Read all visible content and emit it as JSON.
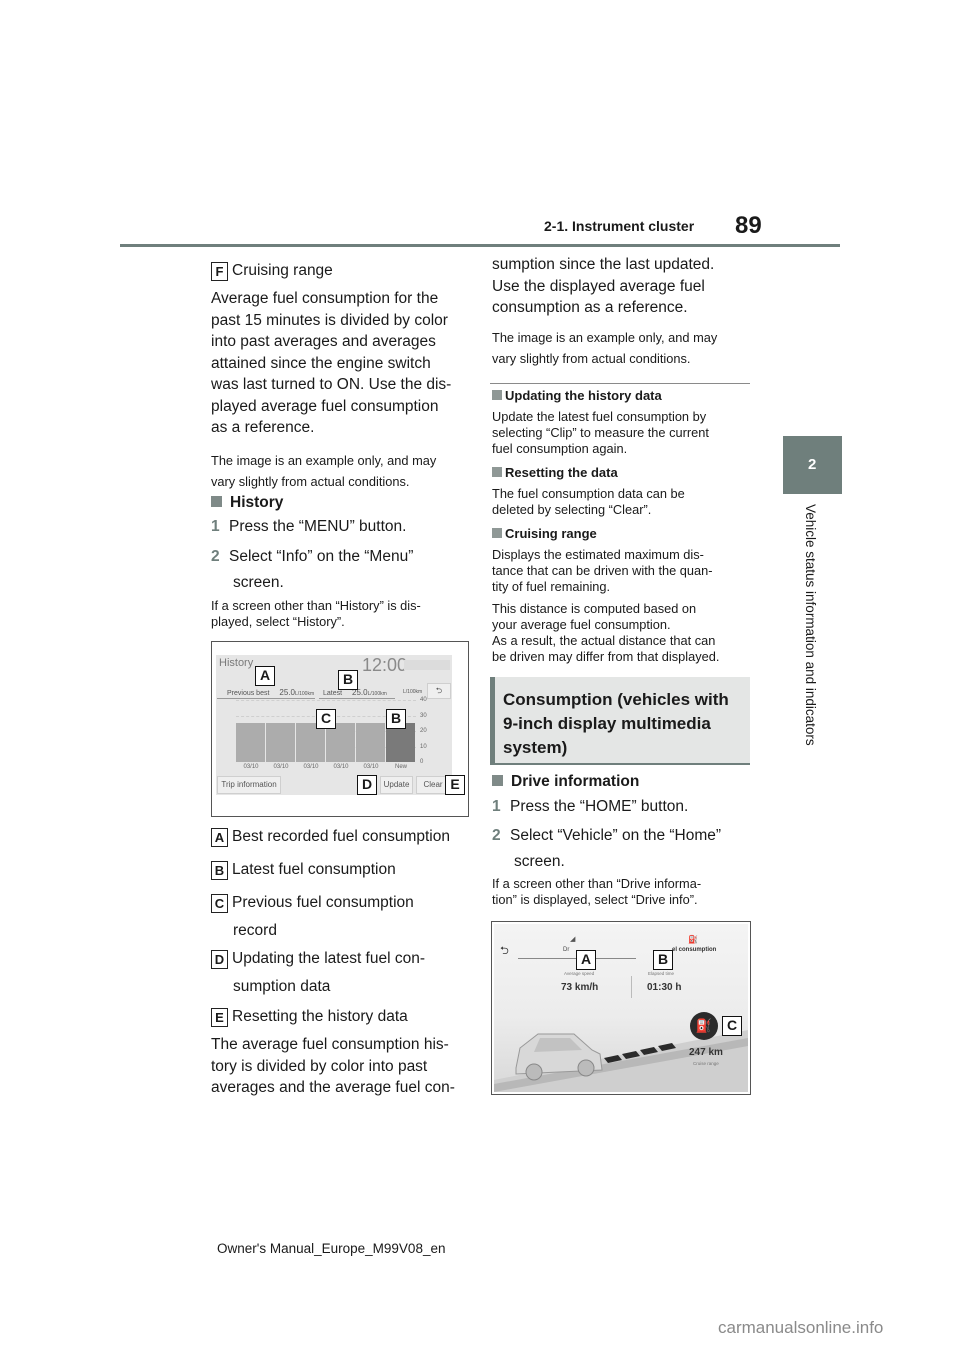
{
  "header": {
    "section": "2-1. Instrument cluster",
    "page_number": "89"
  },
  "side_tab": {
    "chapter_number": "2",
    "chapter_title": "Vehicle status information and indicators"
  },
  "left_column": {
    "item_f": {
      "letter": "F",
      "text": "Cruising range"
    },
    "paragraph1": [
      "Average fuel consumption for the",
      "past 15 minutes is divided by color",
      "into past averages and averages",
      "attained since the engine switch",
      "was last turned to ON. Use the dis-",
      "played average fuel consumption",
      "as a reference."
    ],
    "note1": [
      "The image is an example only, and may",
      "vary slightly from actual conditions."
    ],
    "history_heading": "History",
    "steps": [
      {
        "num": "1",
        "text": "Press the “MENU” button."
      },
      {
        "num": "2",
        "text": "Select “Info” on the “Menu”",
        "text2": "screen."
      }
    ],
    "history_note": [
      "If a screen other than “History” is dis-",
      "played, select “History”."
    ],
    "legend": [
      {
        "letter": "A",
        "text": "Best recorded fuel consumption"
      },
      {
        "letter": "B",
        "text": "Latest fuel consumption"
      },
      {
        "letter": "C",
        "text": "Previous fuel consumption",
        "text2": "record"
      },
      {
        "letter": "D",
        "text": "Updating the latest fuel con-",
        "text2": "sumption data"
      },
      {
        "letter": "E",
        "text": "Resetting the history data"
      }
    ],
    "paragraph2": [
      "The average fuel consumption his-",
      "tory is divided by color into past",
      "averages and the average fuel con-"
    ]
  },
  "history_screen": {
    "title": "History",
    "clock": "12:00",
    "previous_best_label": "Previous best",
    "previous_best_value": "25.0",
    "previous_best_unit": "L/100km",
    "latest_label": "Latest",
    "latest_value": "25.0",
    "latest_unit": "L/100km",
    "axis_unit": "L/100km",
    "y_ticks": [
      "40",
      "30",
      "20",
      "10",
      "0"
    ],
    "x_labels": [
      "03/10",
      "03/10",
      "03/10",
      "03/10",
      "03/10",
      "New"
    ],
    "bar_values": [
      25,
      25,
      25,
      25,
      25,
      25
    ],
    "trip_info_button": "Trip information",
    "update_button": "Update",
    "clear_button": "Clear",
    "callouts": [
      "A",
      "B",
      "C",
      "B",
      "D",
      "E"
    ]
  },
  "right_column": {
    "paragraph_cont": [
      "sumption since the last updated.",
      "Use the displayed average fuel",
      "consumption as a reference."
    ],
    "note": [
      "The image is an example only, and may",
      "vary slightly from actual conditions."
    ],
    "updating_heading": "Updating the history data",
    "updating_text": [
      "Update the latest fuel consumption by",
      "selecting “Clip” to measure the current",
      "fuel consumption again."
    ],
    "resetting_heading": "Resetting the data",
    "resetting_text": [
      "The fuel consumption data can be",
      "deleted by selecting “Clear”."
    ],
    "cruising_heading": "Cruising range",
    "cruising_text1": [
      "Displays the estimated maximum dis-",
      "tance that can be driven with the quan-",
      "tity of fuel remaining."
    ],
    "cruising_text2": [
      "This distance is computed based on",
      "your average fuel consumption.",
      "As a result, the actual distance that can",
      "be driven may differ from that displayed."
    ],
    "section_title": [
      "Consumption (vehicles with",
      "9-inch display multimedia",
      "system)"
    ],
    "drive_heading": "Drive information",
    "steps": [
      {
        "num": "1",
        "text": "Press the “HOME” button."
      },
      {
        "num": "2",
        "text": "Select “Vehicle” on the “Home”",
        "text2": "screen."
      }
    ],
    "drive_note": [
      "If a screen other than “Drive informa-",
      "tion” is displayed, select “Drive info”."
    ]
  },
  "drive_screen": {
    "tab_left": "Dr",
    "tab_right": "el consumption",
    "avg_speed_label": "Average speed",
    "avg_speed_value": "73 km/h",
    "elapsed_label": "Elapsed time",
    "elapsed_value": "01:30 h",
    "range_value": "247 km",
    "range_label": "Cruise range",
    "callouts": [
      "A",
      "B",
      "C"
    ]
  },
  "footer": {
    "doc_id": "Owner's Manual_Europe_M99V08_en",
    "watermark": "carmanualsonline.info"
  }
}
